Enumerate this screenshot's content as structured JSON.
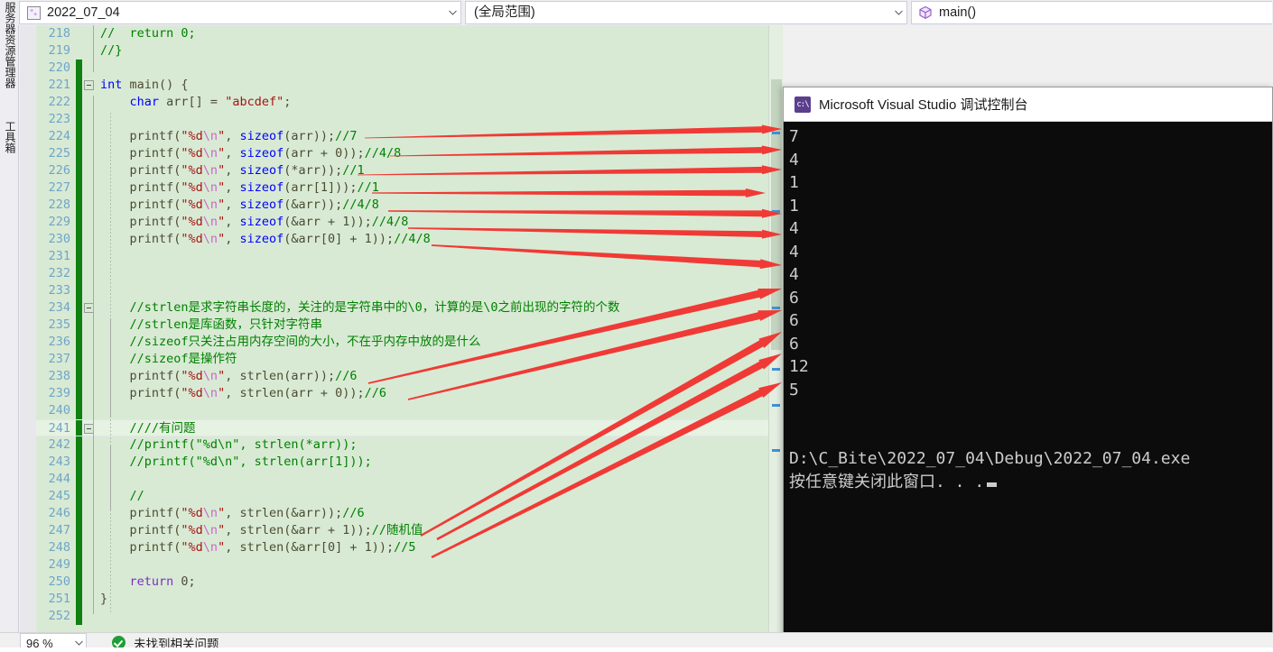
{
  "navbar": {
    "project_combo": {
      "value": "2022_07_04",
      "icon": "project-icon",
      "arrow": "chevron-down-icon"
    },
    "scope_combo": {
      "value": "(全局范围)",
      "arrow": "chevron-down-icon"
    },
    "function_combo": {
      "value": "main()",
      "icon": "method-cube-icon"
    }
  },
  "left_rail": {
    "tabs": [
      "服务器资源管理器",
      "工具箱"
    ]
  },
  "editor": {
    "lines": [
      {
        "n": "218",
        "changed": false,
        "fold": "",
        "indent": 0,
        "tokens": [
          {
            "t": "//  return 0;",
            "c": "cm"
          }
        ]
      },
      {
        "n": "219",
        "changed": false,
        "fold": "",
        "indent": 0,
        "tokens": [
          {
            "t": "//}",
            "c": "cm"
          }
        ]
      },
      {
        "n": "220",
        "changed": true,
        "fold": "",
        "indent": 0,
        "tokens": []
      },
      {
        "n": "221",
        "changed": true,
        "fold": "minus",
        "indent": 0,
        "tokens": [
          {
            "t": "int ",
            "c": "kw"
          },
          {
            "t": "main() {",
            "c": "fn"
          }
        ]
      },
      {
        "n": "222",
        "changed": true,
        "fold": "",
        "indent": 1,
        "tokens": [
          {
            "t": "char ",
            "c": "kw"
          },
          {
            "t": "arr[] = ",
            "c": "fn"
          },
          {
            "t": "\"abcdef\"",
            "c": "str"
          },
          {
            "t": ";",
            "c": "fn"
          }
        ]
      },
      {
        "n": "223",
        "changed": true,
        "fold": "",
        "indent": 1,
        "tokens": []
      },
      {
        "n": "224",
        "changed": true,
        "fold": "",
        "indent": 1,
        "tokens": [
          {
            "t": "printf(",
            "c": "fn"
          },
          {
            "t": "\"%d",
            "c": "str"
          },
          {
            "t": "\\n",
            "c": "esc"
          },
          {
            "t": "\"",
            "c": "str"
          },
          {
            "t": ", ",
            "c": "fn"
          },
          {
            "t": "sizeof",
            "c": "kw"
          },
          {
            "t": "(arr));",
            "c": "fn"
          },
          {
            "t": "//7",
            "c": "cm"
          }
        ]
      },
      {
        "n": "225",
        "changed": true,
        "fold": "",
        "indent": 1,
        "tokens": [
          {
            "t": "printf(",
            "c": "fn"
          },
          {
            "t": "\"%d",
            "c": "str"
          },
          {
            "t": "\\n",
            "c": "esc"
          },
          {
            "t": "\"",
            "c": "str"
          },
          {
            "t": ", ",
            "c": "fn"
          },
          {
            "t": "sizeof",
            "c": "kw"
          },
          {
            "t": "(arr + 0));",
            "c": "fn"
          },
          {
            "t": "//4/8",
            "c": "cm"
          }
        ]
      },
      {
        "n": "226",
        "changed": true,
        "fold": "",
        "indent": 1,
        "tokens": [
          {
            "t": "printf(",
            "c": "fn"
          },
          {
            "t": "\"%d",
            "c": "str"
          },
          {
            "t": "\\n",
            "c": "esc"
          },
          {
            "t": "\"",
            "c": "str"
          },
          {
            "t": ", ",
            "c": "fn"
          },
          {
            "t": "sizeof",
            "c": "kw"
          },
          {
            "t": "(*arr));",
            "c": "fn"
          },
          {
            "t": "//1",
            "c": "cm"
          }
        ]
      },
      {
        "n": "227",
        "changed": true,
        "fold": "",
        "indent": 1,
        "tokens": [
          {
            "t": "printf(",
            "c": "fn"
          },
          {
            "t": "\"%d",
            "c": "str"
          },
          {
            "t": "\\n",
            "c": "esc"
          },
          {
            "t": "\"",
            "c": "str"
          },
          {
            "t": ", ",
            "c": "fn"
          },
          {
            "t": "sizeof",
            "c": "kw"
          },
          {
            "t": "(arr[1]));",
            "c": "fn"
          },
          {
            "t": "//1",
            "c": "cm"
          }
        ]
      },
      {
        "n": "228",
        "changed": true,
        "fold": "",
        "indent": 1,
        "tokens": [
          {
            "t": "printf(",
            "c": "fn"
          },
          {
            "t": "\"%d",
            "c": "str"
          },
          {
            "t": "\\n",
            "c": "esc"
          },
          {
            "t": "\"",
            "c": "str"
          },
          {
            "t": ", ",
            "c": "fn"
          },
          {
            "t": "sizeof",
            "c": "kw"
          },
          {
            "t": "(&arr));",
            "c": "fn"
          },
          {
            "t": "//4/8",
            "c": "cm"
          }
        ]
      },
      {
        "n": "229",
        "changed": true,
        "fold": "",
        "indent": 1,
        "tokens": [
          {
            "t": "printf(",
            "c": "fn"
          },
          {
            "t": "\"%d",
            "c": "str"
          },
          {
            "t": "\\n",
            "c": "esc"
          },
          {
            "t": "\"",
            "c": "str"
          },
          {
            "t": ", ",
            "c": "fn"
          },
          {
            "t": "sizeof",
            "c": "kw"
          },
          {
            "t": "(&arr + 1));",
            "c": "fn"
          },
          {
            "t": "//4/8",
            "c": "cm"
          }
        ]
      },
      {
        "n": "230",
        "changed": true,
        "fold": "",
        "indent": 1,
        "tokens": [
          {
            "t": "printf(",
            "c": "fn"
          },
          {
            "t": "\"%d",
            "c": "str"
          },
          {
            "t": "\\n",
            "c": "esc"
          },
          {
            "t": "\"",
            "c": "str"
          },
          {
            "t": ", ",
            "c": "fn"
          },
          {
            "t": "sizeof",
            "c": "kw"
          },
          {
            "t": "(&arr[0] + 1));",
            "c": "fn"
          },
          {
            "t": "//4/8",
            "c": "cm"
          }
        ]
      },
      {
        "n": "231",
        "changed": true,
        "fold": "",
        "indent": 1,
        "tokens": []
      },
      {
        "n": "232",
        "changed": true,
        "fold": "",
        "indent": 1,
        "tokens": []
      },
      {
        "n": "233",
        "changed": true,
        "fold": "",
        "indent": 1,
        "tokens": []
      },
      {
        "n": "234",
        "changed": true,
        "fold": "minus",
        "indent": 1,
        "tokens": [
          {
            "t": "//strlen是求字符串长度的，关注的是字符串中的\\0，计算的是\\0之前出现的字符的个数",
            "c": "cm"
          }
        ]
      },
      {
        "n": "235",
        "changed": true,
        "fold": "",
        "indent": 1,
        "tokens": [
          {
            "t": "//strlen是库函数，只针对字符串",
            "c": "cm"
          }
        ]
      },
      {
        "n": "236",
        "changed": true,
        "fold": "",
        "indent": 1,
        "tokens": [
          {
            "t": "//sizeof只关注占用内存空间的大小，不在乎内存中放的是什么",
            "c": "cm"
          }
        ]
      },
      {
        "n": "237",
        "changed": true,
        "fold": "",
        "indent": 1,
        "tokens": [
          {
            "t": "//sizeof是操作符",
            "c": "cm"
          }
        ]
      },
      {
        "n": "238",
        "changed": true,
        "fold": "",
        "indent": 1,
        "tokens": [
          {
            "t": "printf(",
            "c": "fn"
          },
          {
            "t": "\"%d",
            "c": "str"
          },
          {
            "t": "\\n",
            "c": "esc"
          },
          {
            "t": "\"",
            "c": "str"
          },
          {
            "t": ", ",
            "c": "fn"
          },
          {
            "t": "strlen(arr));",
            "c": "fn"
          },
          {
            "t": "//6",
            "c": "cm"
          }
        ]
      },
      {
        "n": "239",
        "changed": true,
        "fold": "",
        "indent": 1,
        "tokens": [
          {
            "t": "printf(",
            "c": "fn"
          },
          {
            "t": "\"%d",
            "c": "str"
          },
          {
            "t": "\\n",
            "c": "esc"
          },
          {
            "t": "\"",
            "c": "str"
          },
          {
            "t": ", ",
            "c": "fn"
          },
          {
            "t": "strlen(arr + 0));",
            "c": "fn"
          },
          {
            "t": "//6",
            "c": "cm"
          }
        ]
      },
      {
        "n": "240",
        "changed": true,
        "fold": "",
        "indent": 1,
        "tokens": []
      },
      {
        "n": "241",
        "changed": true,
        "fold": "minus",
        "current": true,
        "indent": 1,
        "tokens": [
          {
            "t": "////有问题",
            "c": "cm"
          }
        ]
      },
      {
        "n": "242",
        "changed": true,
        "fold": "",
        "indent": 1,
        "tokens": [
          {
            "t": "//printf(\"%d\\n\", strlen(*arr));",
            "c": "cm"
          }
        ]
      },
      {
        "n": "243",
        "changed": true,
        "fold": "",
        "indent": 1,
        "tokens": [
          {
            "t": "//printf(\"%d\\n\", strlen(arr[1]));",
            "c": "cm"
          }
        ]
      },
      {
        "n": "244",
        "changed": true,
        "fold": "",
        "indent": 1,
        "tokens": []
      },
      {
        "n": "245",
        "changed": true,
        "fold": "",
        "indent": 1,
        "tokens": [
          {
            "t": "//",
            "c": "cm"
          }
        ]
      },
      {
        "n": "246",
        "changed": true,
        "fold": "",
        "indent": 1,
        "tokens": [
          {
            "t": "printf(",
            "c": "fn"
          },
          {
            "t": "\"%d",
            "c": "str"
          },
          {
            "t": "\\n",
            "c": "esc"
          },
          {
            "t": "\"",
            "c": "str"
          },
          {
            "t": ", ",
            "c": "fn"
          },
          {
            "t": "strlen(&arr));",
            "c": "fn"
          },
          {
            "t": "//6",
            "c": "cm"
          }
        ]
      },
      {
        "n": "247",
        "changed": true,
        "fold": "",
        "indent": 1,
        "tokens": [
          {
            "t": "printf(",
            "c": "fn"
          },
          {
            "t": "\"%d",
            "c": "str"
          },
          {
            "t": "\\n",
            "c": "esc"
          },
          {
            "t": "\"",
            "c": "str"
          },
          {
            "t": ", ",
            "c": "fn"
          },
          {
            "t": "strlen(&arr + 1));",
            "c": "fn"
          },
          {
            "t": "//随机值",
            "c": "cm"
          }
        ]
      },
      {
        "n": "248",
        "changed": true,
        "fold": "",
        "indent": 1,
        "tokens": [
          {
            "t": "printf(",
            "c": "fn"
          },
          {
            "t": "\"%d",
            "c": "str"
          },
          {
            "t": "\\n",
            "c": "esc"
          },
          {
            "t": "\"",
            "c": "str"
          },
          {
            "t": ", ",
            "c": "fn"
          },
          {
            "t": "strlen(&arr[0] + 1));",
            "c": "fn"
          },
          {
            "t": "//5",
            "c": "cm"
          }
        ]
      },
      {
        "n": "249",
        "changed": true,
        "fold": "",
        "indent": 1,
        "tokens": []
      },
      {
        "n": "250",
        "changed": true,
        "fold": "",
        "indent": 1,
        "tokens": [
          {
            "t": "return ",
            "c": "ret"
          },
          {
            "t": "0;",
            "c": "fn"
          }
        ]
      },
      {
        "n": "251",
        "changed": true,
        "fold": "",
        "indent": 0,
        "tokens": [
          {
            "t": "}",
            "c": "fn"
          }
        ]
      },
      {
        "n": "252",
        "changed": true,
        "fold": "",
        "indent": 0,
        "tokens": []
      }
    ]
  },
  "console": {
    "title": "Microsoft Visual Studio 调试控制台",
    "title_icon": "cmd-prompt-icon",
    "output": [
      "7",
      "4",
      "1",
      "1",
      "4",
      "4",
      "4",
      "6",
      "6",
      "6",
      "12",
      "5",
      "",
      "",
      "D:\\C_Bite\\2022_07_04\\Debug\\2022_07_04.exe"
    ],
    "prompt": "按任意键关闭此窗口. . ."
  },
  "annotations": {
    "color": "#f03a36",
    "arrow_count": 12,
    "description": "红色箭头将代码注释的期望值连到控制台输出"
  },
  "statusbar": {
    "zoom": "96 %",
    "zoom_arrow": "chevron-down-icon",
    "message": "未找到相关问题",
    "message_icon": "green-check-icon"
  }
}
